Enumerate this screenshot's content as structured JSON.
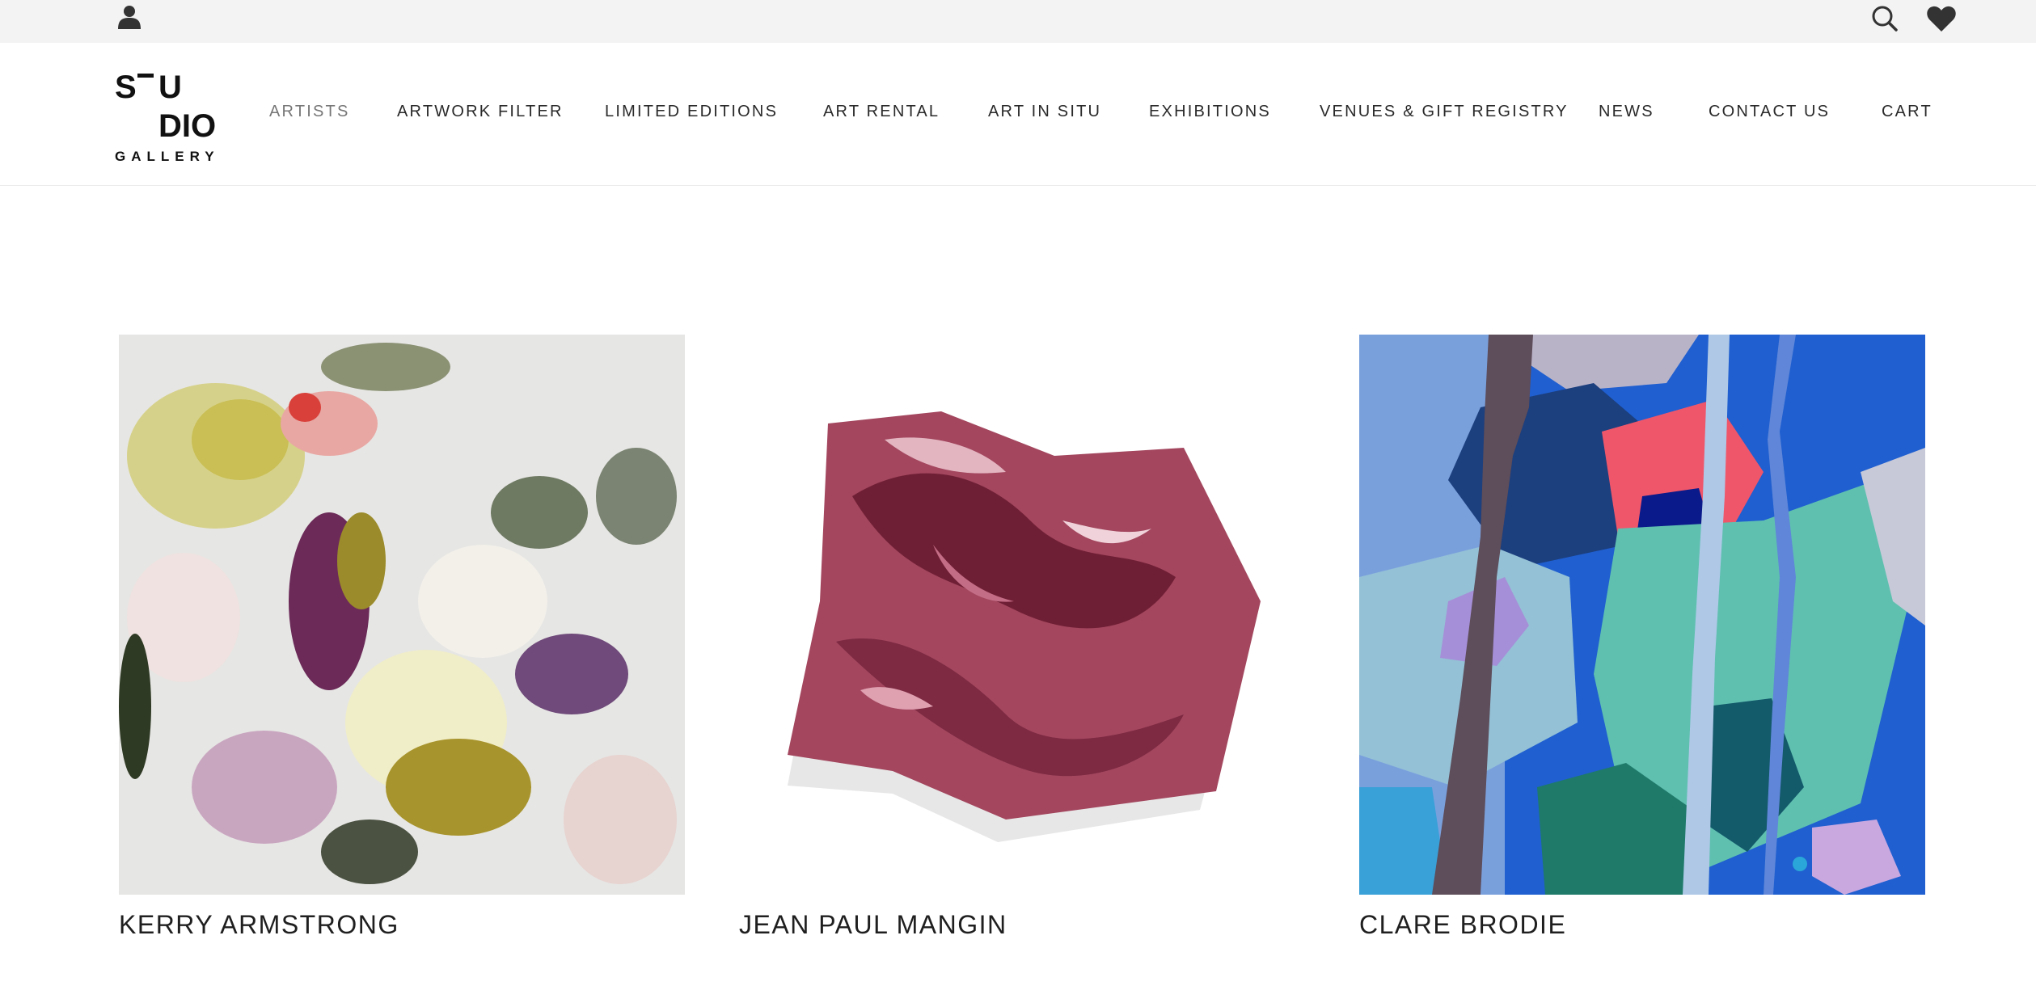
{
  "topbar": {
    "account_icon": "user-icon",
    "search_icon": "search-icon",
    "wishlist_icon": "heart-icon"
  },
  "logo": {
    "line1": "S",
    "line1b": "U",
    "line2": "DIO",
    "line3": "GALLERY"
  },
  "nav": {
    "items": [
      {
        "label": "ARTISTS",
        "active": true
      },
      {
        "label": "ARTWORK FILTER"
      },
      {
        "label": "LIMITED EDITIONS"
      },
      {
        "label": "ART RENTAL"
      },
      {
        "label": "ART IN SITU"
      },
      {
        "label": "EXHIBITIONS"
      },
      {
        "label": "VENUES & GIFT REGISTRY"
      },
      {
        "label": "NEWS"
      },
      {
        "label": "CONTACT US"
      },
      {
        "label": "CART"
      }
    ]
  },
  "artists": [
    {
      "name": "KERRY ARMSTRONG"
    },
    {
      "name": "JEAN PAUL MANGIN"
    },
    {
      "name": "CLARE BRODIE"
    }
  ]
}
